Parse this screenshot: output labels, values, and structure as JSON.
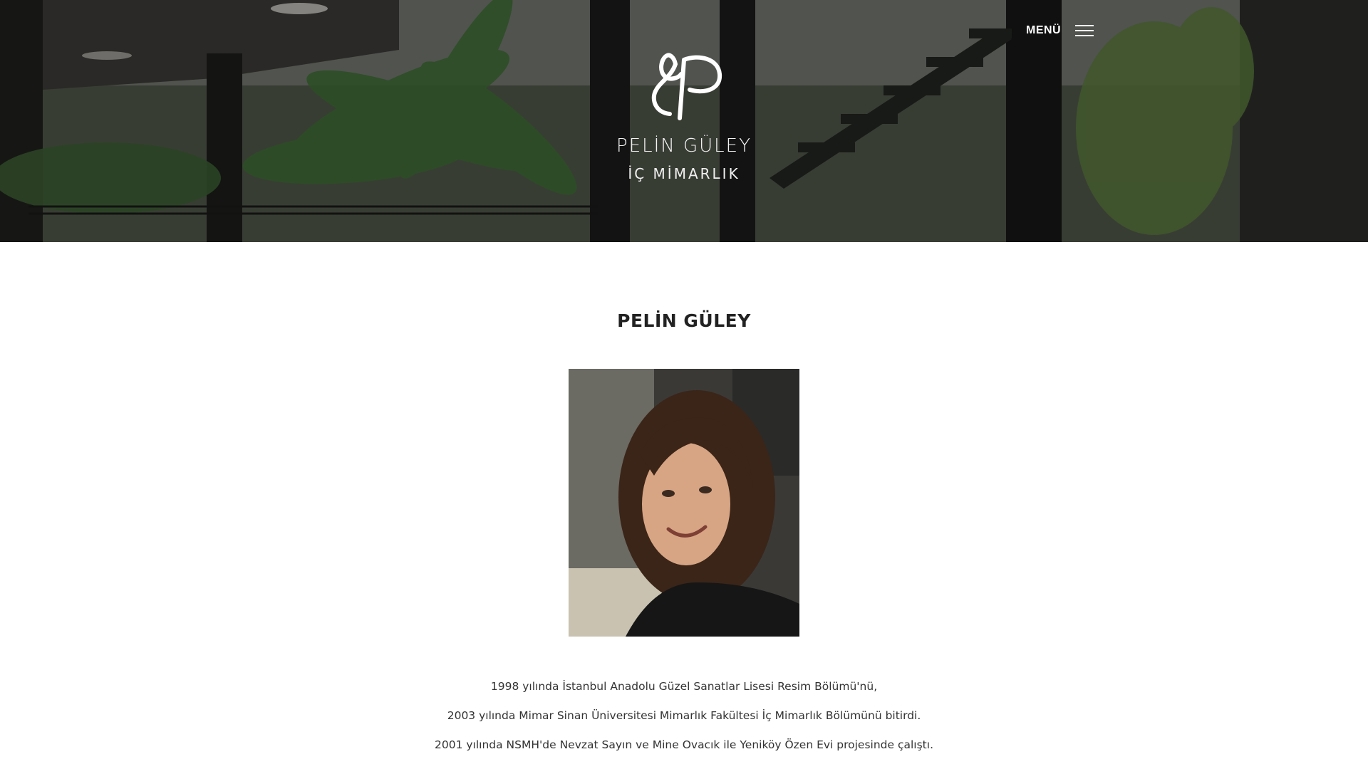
{
  "header": {
    "brand_name": "PELİN GÜLEY",
    "brand_subtitle": "İÇ MİMARLIK",
    "menu_label": "MENÜ",
    "logo_icon": "pg-monogram-logo",
    "menu_icon": "hamburger-icon"
  },
  "main": {
    "title": "PELİN GÜLEY",
    "bio": [
      "1998 yılında İstanbul Anadolu Güzel Sanatlar Lisesi Resim Bölümü'nü,",
      "2003 yılında Mimar Sinan Üniversitesi Mimarlık Fakültesi İç Mimarlık Bölümünü bitirdi.",
      "2001 yılında NSMH'de Nevzat Sayın ve Mine Ovacık ile Yeniköy Özen Evi projesinde çalıştı."
    ]
  },
  "colors": {
    "text": "#333333",
    "title": "#222222",
    "header_text": "#ffffff"
  }
}
